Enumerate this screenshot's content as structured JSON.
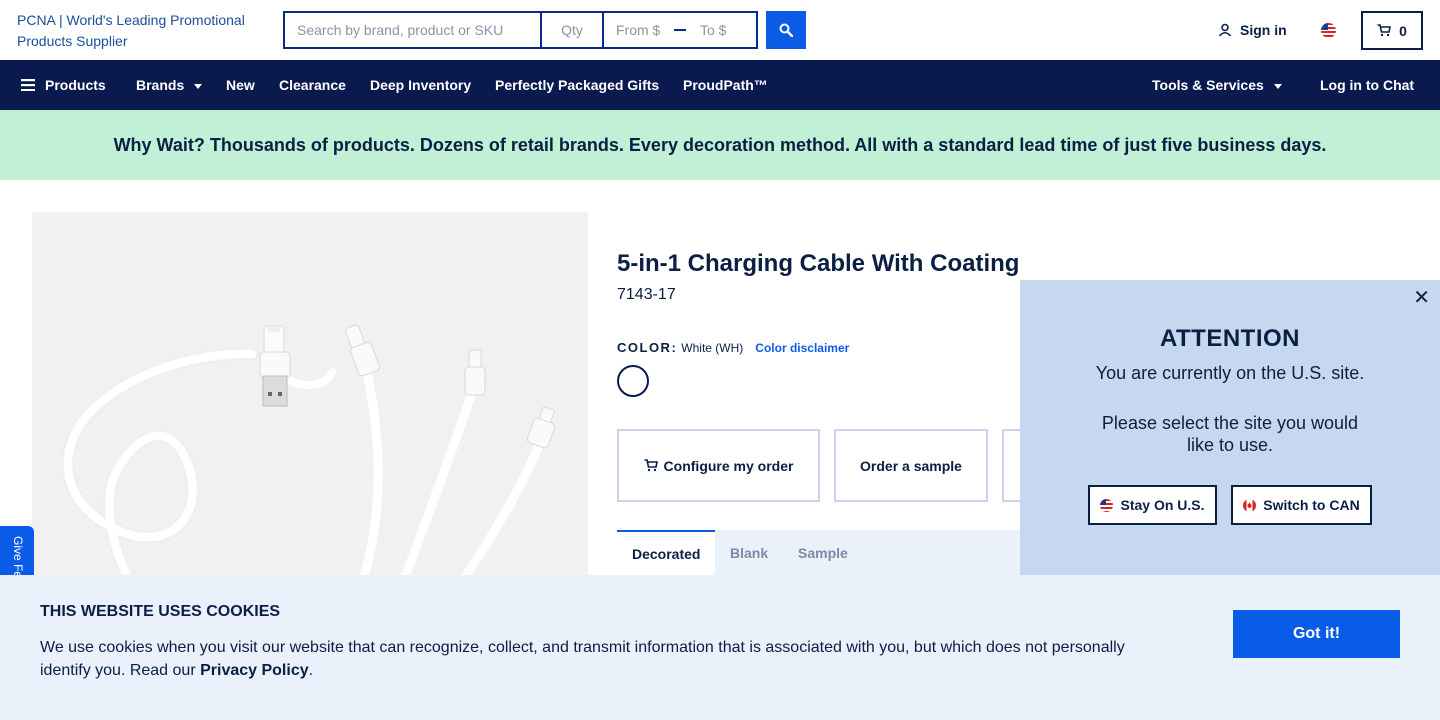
{
  "header": {
    "logo_alt": "PCNA | World's Leading Promotional Products Supplier",
    "search_placeholder": "Search by brand, product or SKU",
    "qty_placeholder": "Qty",
    "price_from_placeholder": "From $",
    "price_to_placeholder": "To $",
    "signin_label": "Sign in",
    "cart_count": "0",
    "locale_icon": "us-flag-icon"
  },
  "nav": {
    "items": [
      {
        "label": "Products"
      },
      {
        "label": "Brands"
      },
      {
        "label": "New"
      },
      {
        "label": "Clearance"
      },
      {
        "label": "Deep Inventory"
      },
      {
        "label": "Perfectly Packaged Gifts"
      },
      {
        "label": "ProudPath™"
      }
    ],
    "tools_label": "Tools & Services",
    "chat_label": "Log in to Chat"
  },
  "promo": {
    "text": "Why Wait? Thousands of products. Dozens of retail brands. Every decoration method. All with a standard lead time of just five business days."
  },
  "product": {
    "title": "5-in-1 Charging Cable With Coating",
    "sku": "7143-17",
    "color_key": "COLOR:",
    "color_value": "White (WH)",
    "color_disclaimer": "Color disclaimer",
    "swatch_color": "#ffffff",
    "actions": {
      "configure": "Configure my order",
      "sample": "Order a sample"
    },
    "tabs": [
      "Decorated",
      "Blank",
      "Sample"
    ]
  },
  "feedback": {
    "label": "Give Fe"
  },
  "attention": {
    "title": "ATTENTION",
    "line1": "You are currently on the U.S. site.",
    "line2": "Please select the site you would like to use.",
    "stay_label": "Stay On U.S.",
    "switch_label": "Switch to CAN",
    "close": "✕"
  },
  "cookie": {
    "title": "THIS WEBSITE USES COOKIES",
    "text_before": "We use cookies when you visit our website that can recognize, collect, and transmit information that is associated with you, but which does not personally identify you. Read our ",
    "link": "Privacy Policy",
    "text_after": ".",
    "button": "Got it!"
  },
  "colors": {
    "navy": "#0a1a4f",
    "accent": "#0a5ce6",
    "promo_bg": "#c2f0d6",
    "modal_bg": "#c6d8ef",
    "cookie_bg": "#eaf1fb"
  }
}
